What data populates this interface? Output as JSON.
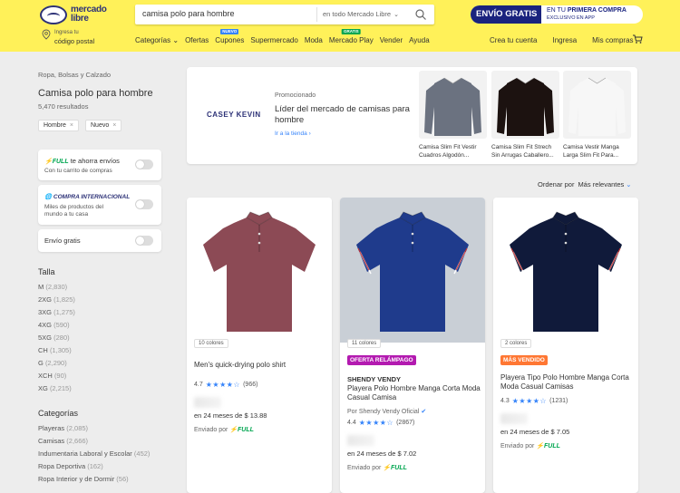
{
  "header": {
    "logo_text_1": "mercado",
    "logo_text_2": "libre",
    "search_value": "camisa polo para hombre",
    "search_scope": "en todo Mercado Libre",
    "promo_main": "ENVÍO GRATIS",
    "promo_line1_a": "EN TU ",
    "promo_line1_b": "PRIMERA COMPRA",
    "promo_line2": "EXCLUSIVO EN APP",
    "postal_small": "Ingresa tu",
    "postal_big": "código postal",
    "nav": [
      {
        "label": "Categorías ⌄",
        "badge": ""
      },
      {
        "label": "Ofertas",
        "badge": ""
      },
      {
        "label": "Cupones",
        "badge": "NUEVO"
      },
      {
        "label": "Supermercado",
        "badge": ""
      },
      {
        "label": "Moda",
        "badge": ""
      },
      {
        "label": "Mercado Play",
        "badge": "GRATIS"
      },
      {
        "label": "Vender",
        "badge": ""
      },
      {
        "label": "Ayuda",
        "badge": ""
      }
    ],
    "account_links": [
      "Crea tu cuenta",
      "Ingresa",
      "Mis compras"
    ]
  },
  "sidebar": {
    "breadcrumb": "Ropa, Bolsas y Calzado",
    "title": "Camisa polo para hombre",
    "results": "5,470 resultados",
    "chips": [
      "Hombre",
      "Nuevo"
    ],
    "full_card": {
      "tag": "FULL",
      "line1_rest": " te ahorra envíos",
      "line2": "Con tu carrito de compras"
    },
    "intl_card": {
      "tag": "COMPRA INTERNACIONAL",
      "line2a": "Miles de productos del",
      "line2b": "mundo a tu casa"
    },
    "free_shipping": "Envío gratis",
    "talla_heading": "Talla",
    "tallas": [
      {
        "name": "M",
        "count": "(2,830)"
      },
      {
        "name": "2XG",
        "count": "(1,825)"
      },
      {
        "name": "3XG",
        "count": "(1,275)"
      },
      {
        "name": "4XG",
        "count": "(590)"
      },
      {
        "name": "5XG",
        "count": "(280)"
      },
      {
        "name": "CH",
        "count": "(1,305)"
      },
      {
        "name": "G",
        "count": "(2,290)"
      },
      {
        "name": "XCH",
        "count": "(90)"
      },
      {
        "name": "XG",
        "count": "(2,215)"
      }
    ],
    "categorias_heading": "Categorías",
    "categorias": [
      {
        "name": "Playeras",
        "count": "(2,085)"
      },
      {
        "name": "Camisas",
        "count": "(2,666)"
      },
      {
        "name": "Indumentaria Laboral y Escolar",
        "count": "(452)"
      },
      {
        "name": "Ropa Deportiva",
        "count": "(162)"
      },
      {
        "name": "Ropa Interior y de Dormir",
        "count": "(56)"
      }
    ]
  },
  "brand_box": {
    "logo": "CASEY KEVIN",
    "promo": "Promocionado",
    "headline": "Líder del mercado de camisas para hombre",
    "link": "Ir a la tienda  ›",
    "products": [
      {
        "title": "Camisa Slim Fit Vestir Cuadros Algodón...",
        "color": "#6b7280"
      },
      {
        "title": "Camisa Slim Fit Strech Sin Arrugas Caballero...",
        "color": "#1c1210"
      },
      {
        "title": "Camisa Vestir Manga Larga Slim Fit Para...",
        "color": "#f7f7f7"
      }
    ]
  },
  "sort": {
    "label": "Ordenar por",
    "value": "Más relevantes",
    "chev": "⌄"
  },
  "cards": [
    {
      "colors": "10 colores",
      "badge": "",
      "badge_color": "",
      "brand": "",
      "title": "Men's quick-drying polo shirt",
      "seller": "",
      "rating": "4.7",
      "reviews": "(966)",
      "installments": "en 24 meses de $ 13.88",
      "sent_prefix": "Enviado por",
      "sent_tag": "FULL",
      "shirt_color": "#8c4a55"
    },
    {
      "colors": "11 colores",
      "badge": "OFERTA RELÁMPAGO",
      "badge_color": "#b31ab0",
      "brand": "SHENDY VENDY",
      "title": "Playera Polo Hombre Manga Corta Moda Casual Camisa",
      "seller": "Por Shendy Vendy Oficial",
      "rating": "4.4",
      "reviews": "(2867)",
      "installments": "en 24 meses de $ 7.02",
      "sent_prefix": "Enviado por",
      "sent_tag": "FULL",
      "shirt_color": "#1f3b8c"
    },
    {
      "colors": "2 colores",
      "badge": "MÁS VENDIDO",
      "badge_color": "#ff7733",
      "brand": "",
      "title": "Playera Tipo Polo Hombre Manga Corta Moda Casual Camisas",
      "seller": "",
      "rating": "4.3",
      "reviews": "(1231)",
      "installments": "en 24 meses de $ 7.05",
      "sent_prefix": "Enviado por",
      "sent_tag": "FULL",
      "shirt_color": "#101a3a"
    }
  ]
}
